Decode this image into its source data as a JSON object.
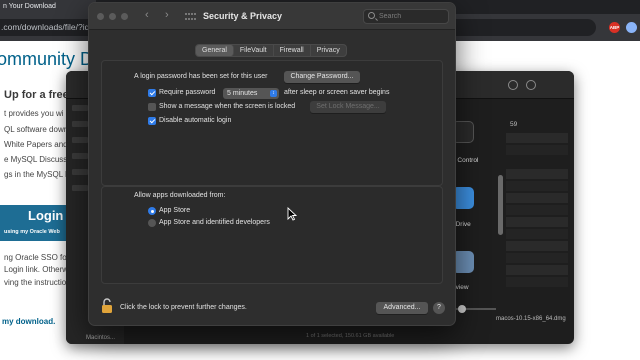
{
  "browser": {
    "tab_title": "n Your Download",
    "url": ".com/downloads/file/?id",
    "abp_label": "ABP",
    "page": {
      "heading": "ommunity D",
      "up_for": "Up for a free a",
      "lines": [
        "t provides you wi",
        "QL software downlo",
        "White Papers and",
        "e MySQL Discussi",
        "gs in the MySQL bu"
      ],
      "login_big": "Login",
      "login_small": "using my Oracle Web",
      "sso_lines": [
        "ng Oracle SSO for",
        "Login link. Otherw",
        "ving the instructio"
      ],
      "download_link": "my download."
    }
  },
  "finder": {
    "col_value": "59",
    "apps": [
      {
        "label": "n Control",
        "color": "#2b2b2b"
      },
      {
        "label": "eDrive",
        "color": "#3c8fe0"
      },
      {
        "label": "eview",
        "color": "#6c8fb5"
      }
    ],
    "status": "1 of 1 selected, 150.61 GB available",
    "dmg_name": "macos-10.15-x86_64.dmg",
    "sidebar_bottom": "Macintos..."
  },
  "prefs": {
    "title": "Security & Privacy",
    "search_placeholder": "Search",
    "tabs": [
      {
        "label": "General",
        "active": true
      },
      {
        "label": "FileVault",
        "active": false
      },
      {
        "label": "Firewall",
        "active": false
      },
      {
        "label": "Privacy",
        "active": false
      }
    ],
    "login_password_text": "A login password has been set for this user",
    "change_password_button": "Change Password...",
    "require_password": {
      "label": "Require password",
      "checked": true,
      "value": "5 minutes",
      "suffix": "after sleep or screen saver begins"
    },
    "show_message": {
      "label": "Show a message when the screen is locked",
      "checked": false,
      "button": "Set Lock Message..."
    },
    "disable_auto_login": {
      "label": "Disable automatic login",
      "checked": true
    },
    "allow_apps_label": "Allow apps downloaded from:",
    "allow_options": [
      {
        "label": "App Store",
        "selected": true
      },
      {
        "label": "App Store and identified developers",
        "selected": false
      }
    ],
    "lock_text": "Click the lock to prevent further changes.",
    "advanced_button": "Advanced...",
    "help_label": "?"
  },
  "colors": {
    "accent": "#2f7be8",
    "window_bg": "#2e2e2e",
    "lock": "#e0a43a",
    "link": "#00618a"
  }
}
